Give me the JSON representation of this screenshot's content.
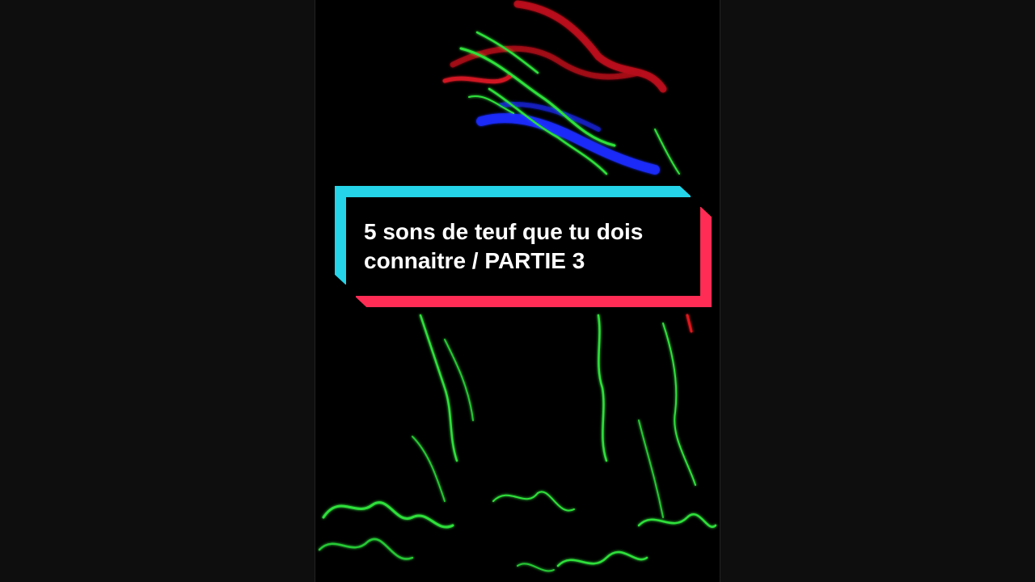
{
  "video": {
    "title_card": {
      "text": "5 sons de teuf que tu dois connaitre / PARTIE 3"
    }
  },
  "colors": {
    "page_background": "#0e0e0e",
    "frame_background": "#000000",
    "accent_cyan": "#25d4e8",
    "accent_red": "#ff2d55",
    "neon_green": "#2fe03a",
    "neon_blue": "#1a2cff",
    "neon_red": "#e0141e"
  }
}
